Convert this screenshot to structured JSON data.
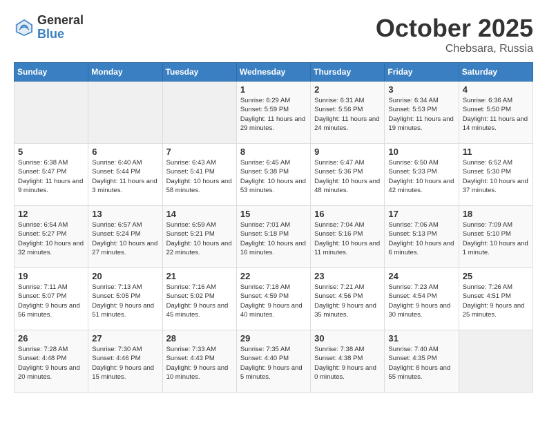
{
  "header": {
    "logo_general": "General",
    "logo_blue": "Blue",
    "month_title": "October 2025",
    "location": "Chebsara, Russia"
  },
  "weekdays": [
    "Sunday",
    "Monday",
    "Tuesday",
    "Wednesday",
    "Thursday",
    "Friday",
    "Saturday"
  ],
  "weeks": [
    [
      {
        "day": "",
        "info": ""
      },
      {
        "day": "",
        "info": ""
      },
      {
        "day": "",
        "info": ""
      },
      {
        "day": "1",
        "info": "Sunrise: 6:29 AM\nSunset: 5:59 PM\nDaylight: 11 hours\nand 29 minutes."
      },
      {
        "day": "2",
        "info": "Sunrise: 6:31 AM\nSunset: 5:56 PM\nDaylight: 11 hours\nand 24 minutes."
      },
      {
        "day": "3",
        "info": "Sunrise: 6:34 AM\nSunset: 5:53 PM\nDaylight: 11 hours\nand 19 minutes."
      },
      {
        "day": "4",
        "info": "Sunrise: 6:36 AM\nSunset: 5:50 PM\nDaylight: 11 hours\nand 14 minutes."
      }
    ],
    [
      {
        "day": "5",
        "info": "Sunrise: 6:38 AM\nSunset: 5:47 PM\nDaylight: 11 hours\nand 9 minutes."
      },
      {
        "day": "6",
        "info": "Sunrise: 6:40 AM\nSunset: 5:44 PM\nDaylight: 11 hours\nand 3 minutes."
      },
      {
        "day": "7",
        "info": "Sunrise: 6:43 AM\nSunset: 5:41 PM\nDaylight: 10 hours\nand 58 minutes."
      },
      {
        "day": "8",
        "info": "Sunrise: 6:45 AM\nSunset: 5:38 PM\nDaylight: 10 hours\nand 53 minutes."
      },
      {
        "day": "9",
        "info": "Sunrise: 6:47 AM\nSunset: 5:36 PM\nDaylight: 10 hours\nand 48 minutes."
      },
      {
        "day": "10",
        "info": "Sunrise: 6:50 AM\nSunset: 5:33 PM\nDaylight: 10 hours\nand 42 minutes."
      },
      {
        "day": "11",
        "info": "Sunrise: 6:52 AM\nSunset: 5:30 PM\nDaylight: 10 hours\nand 37 minutes."
      }
    ],
    [
      {
        "day": "12",
        "info": "Sunrise: 6:54 AM\nSunset: 5:27 PM\nDaylight: 10 hours\nand 32 minutes."
      },
      {
        "day": "13",
        "info": "Sunrise: 6:57 AM\nSunset: 5:24 PM\nDaylight: 10 hours\nand 27 minutes."
      },
      {
        "day": "14",
        "info": "Sunrise: 6:59 AM\nSunset: 5:21 PM\nDaylight: 10 hours\nand 22 minutes."
      },
      {
        "day": "15",
        "info": "Sunrise: 7:01 AM\nSunset: 5:18 PM\nDaylight: 10 hours\nand 16 minutes."
      },
      {
        "day": "16",
        "info": "Sunrise: 7:04 AM\nSunset: 5:16 PM\nDaylight: 10 hours\nand 11 minutes."
      },
      {
        "day": "17",
        "info": "Sunrise: 7:06 AM\nSunset: 5:13 PM\nDaylight: 10 hours\nand 6 minutes."
      },
      {
        "day": "18",
        "info": "Sunrise: 7:09 AM\nSunset: 5:10 PM\nDaylight: 10 hours\nand 1 minute."
      }
    ],
    [
      {
        "day": "19",
        "info": "Sunrise: 7:11 AM\nSunset: 5:07 PM\nDaylight: 9 hours\nand 56 minutes."
      },
      {
        "day": "20",
        "info": "Sunrise: 7:13 AM\nSunset: 5:05 PM\nDaylight: 9 hours\nand 51 minutes."
      },
      {
        "day": "21",
        "info": "Sunrise: 7:16 AM\nSunset: 5:02 PM\nDaylight: 9 hours\nand 45 minutes."
      },
      {
        "day": "22",
        "info": "Sunrise: 7:18 AM\nSunset: 4:59 PM\nDaylight: 9 hours\nand 40 minutes."
      },
      {
        "day": "23",
        "info": "Sunrise: 7:21 AM\nSunset: 4:56 PM\nDaylight: 9 hours\nand 35 minutes."
      },
      {
        "day": "24",
        "info": "Sunrise: 7:23 AM\nSunset: 4:54 PM\nDaylight: 9 hours\nand 30 minutes."
      },
      {
        "day": "25",
        "info": "Sunrise: 7:26 AM\nSunset: 4:51 PM\nDaylight: 9 hours\nand 25 minutes."
      }
    ],
    [
      {
        "day": "26",
        "info": "Sunrise: 7:28 AM\nSunset: 4:48 PM\nDaylight: 9 hours\nand 20 minutes."
      },
      {
        "day": "27",
        "info": "Sunrise: 7:30 AM\nSunset: 4:46 PM\nDaylight: 9 hours\nand 15 minutes."
      },
      {
        "day": "28",
        "info": "Sunrise: 7:33 AM\nSunset: 4:43 PM\nDaylight: 9 hours\nand 10 minutes."
      },
      {
        "day": "29",
        "info": "Sunrise: 7:35 AM\nSunset: 4:40 PM\nDaylight: 9 hours\nand 5 minutes."
      },
      {
        "day": "30",
        "info": "Sunrise: 7:38 AM\nSunset: 4:38 PM\nDaylight: 9 hours\nand 0 minutes."
      },
      {
        "day": "31",
        "info": "Sunrise: 7:40 AM\nSunset: 4:35 PM\nDaylight: 8 hours\nand 55 minutes."
      },
      {
        "day": "",
        "info": ""
      }
    ]
  ]
}
